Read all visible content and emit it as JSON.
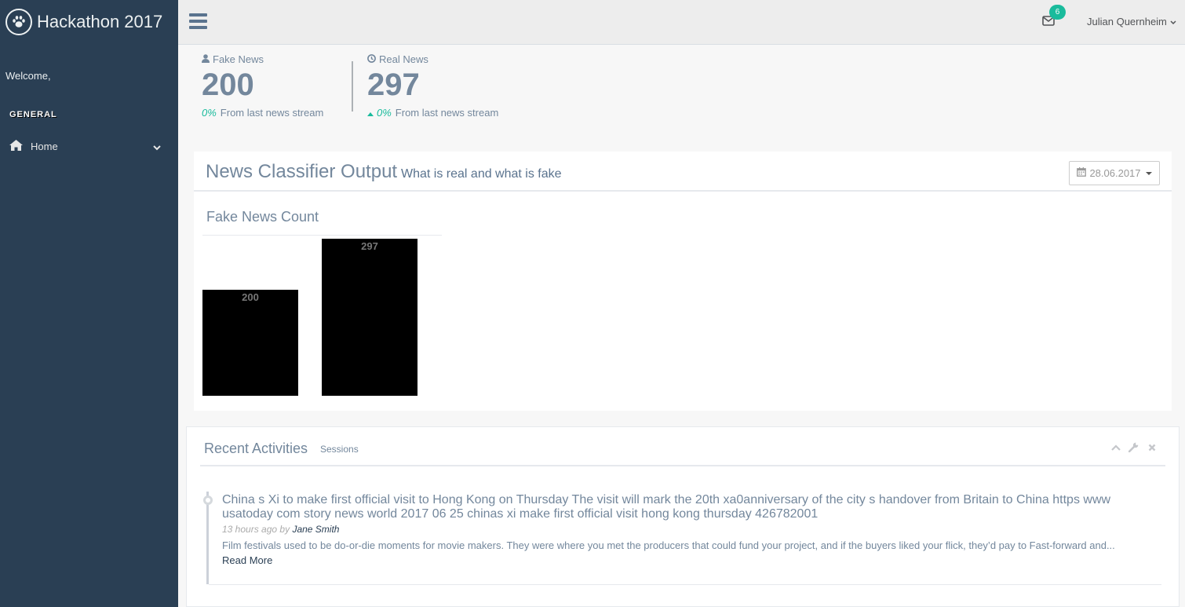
{
  "sidebar": {
    "brand_title": "Hackathon 2017",
    "welcome": "Welcome,",
    "section": "GENERAL",
    "nav_home": "Home"
  },
  "topnav": {
    "notification_count": "6",
    "user_name": "Julian Quernheim"
  },
  "tiles": [
    {
      "label": "Fake News",
      "count": "200",
      "delta": "0%",
      "delta_text": "From last news stream",
      "icon": "user-icon"
    },
    {
      "label": "Real News",
      "count": "297",
      "delta": "0%",
      "delta_text": "From last news stream",
      "icon": "clock-icon"
    }
  ],
  "panel_classifier": {
    "title": "News Classifier Output",
    "subtitle": "What is real and what is fake",
    "date": "28.06.2017",
    "chart_title": "Fake News Count"
  },
  "chart_data": {
    "type": "bar",
    "title": "Fake News Count",
    "categories": [
      "",
      ""
    ],
    "values": [
      200,
      297
    ],
    "ylim": [
      0,
      297
    ],
    "bar_color": "#000000",
    "label_color": "#777777",
    "grid": false
  },
  "panel_activities": {
    "title": "Recent Activities",
    "subtitle": "Sessions",
    "item": {
      "title": "China s Xi to make first official visit to Hong Kong on Thursday The visit will mark the 20th xa0anniversary of the city s handover from Britain to China https www usatoday com story news world 2017 06 25 chinas xi make first official visit hong kong thursday 426782001",
      "time": "13 hours ago",
      "by": "by",
      "author": "Jane Smith",
      "excerpt": "Film festivals used to be do-or-die moments for movie makers. They were where you met the producers that could fund your project, and if the buyers liked your flick, they’d pay to Fast-forward and...",
      "read_more": "Read More"
    }
  },
  "colors": {
    "sidebar_bg": "#2A3F54",
    "accent": "#1ABB9C",
    "text": "#73879C"
  }
}
